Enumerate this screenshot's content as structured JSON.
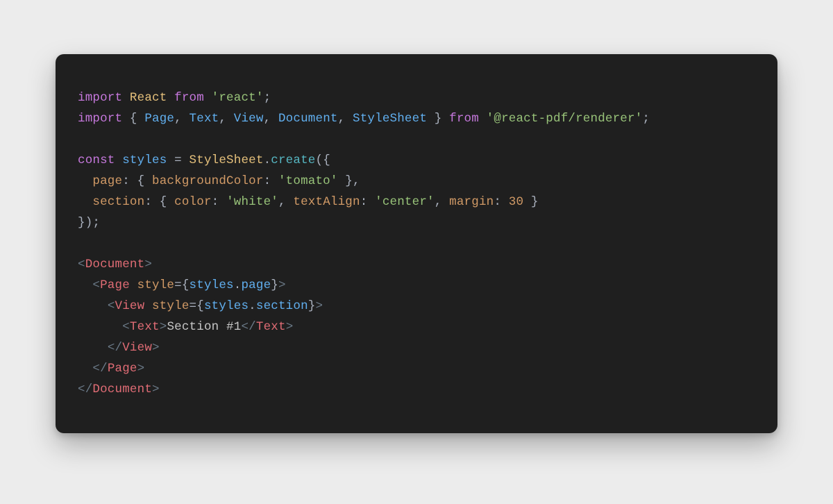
{
  "code": {
    "line1": {
      "import": "import",
      "react": "React",
      "from": "from",
      "module": "'react'",
      "semi": ";"
    },
    "line2": {
      "import": "import",
      "lbrace": "{",
      "items": [
        {
          "name": "Page"
        },
        {
          "name": "Text"
        },
        {
          "name": "View"
        },
        {
          "name": "Document"
        },
        {
          "name": "StyleSheet"
        }
      ],
      "rbrace": "}",
      "from": "from",
      "module": "'@react-pdf/renderer'",
      "semi": ";"
    },
    "line4": {
      "const": "const",
      "styles": "styles",
      "eq": "=",
      "stylesheet": "StyleSheet",
      "dot": ".",
      "create": "create",
      "lparen": "(",
      "lbrace": "{"
    },
    "line5": {
      "prop": "page",
      "colon": ":",
      "lbrace": "{",
      "bgprop": "backgroundColor",
      "bgcolon": ":",
      "bgval": "'tomato'",
      "rbrace": "}",
      "comma": ","
    },
    "line6": {
      "prop": "section",
      "colon": ":",
      "lbrace": "{",
      "colorprop": "color",
      "colorcolon": ":",
      "colorval": "'white'",
      "comma1": ",",
      "taprop": "textAlign",
      "tacolon": ":",
      "taval": "'center'",
      "comma2": ",",
      "mprop": "margin",
      "mcolon": ":",
      "mval": "30",
      "rbrace": "}"
    },
    "line7": {
      "rbrace": "}",
      "rparen": ")",
      "semi": ";"
    },
    "jsx": {
      "documentOpen": {
        "lt": "<",
        "name": "Document",
        "gt": ">"
      },
      "pageOpen": {
        "lt": "<",
        "name": "Page",
        "attr": "style",
        "eq": "=",
        "lbrace": "{",
        "obj": "styles",
        "dot": ".",
        "key": "page",
        "rbrace": "}",
        "gt": ">"
      },
      "viewOpen": {
        "lt": "<",
        "name": "View",
        "attr": "style",
        "eq": "=",
        "lbrace": "{",
        "obj": "styles",
        "dot": ".",
        "key": "section",
        "rbrace": "}",
        "gt": ">"
      },
      "textLine": {
        "lt1": "<",
        "name1": "Text",
        "gt1": ">",
        "content": "Section #1",
        "lt2": "</",
        "name2": "Text",
        "gt2": ">"
      },
      "viewClose": {
        "lt": "</",
        "name": "View",
        "gt": ">"
      },
      "pageClose": {
        "lt": "</",
        "name": "Page",
        "gt": ">"
      },
      "documentClose": {
        "lt": "</",
        "name": "Document",
        "gt": ">"
      }
    }
  }
}
